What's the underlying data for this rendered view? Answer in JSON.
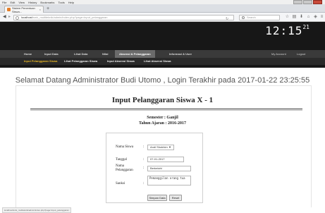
{
  "menubar": {
    "items": [
      "File",
      "Edit",
      "View",
      "History",
      "Bookmarks",
      "Tools",
      "Help"
    ]
  },
  "browser": {
    "tab_title": "Sistem Penentuan Siswa...",
    "new_tab": "+",
    "url_host": "localhost",
    "url_path": "/smk_multiteknik/admin/index.php?page=input_pelanggaran",
    "search_placeholder": "Search"
  },
  "clock": {
    "time": "12:15",
    "seconds": "21"
  },
  "mainnav": {
    "items": [
      "Home",
      "Input Data",
      "Lihat Data",
      "Nilai",
      "Absensi & Pelanggaran",
      "Informasi & User"
    ],
    "my_account": "My Account",
    "logout": "Logout"
  },
  "subnav": {
    "items": [
      "Input Pelanggaran Siswa",
      "Lihat Pelanggaran Siswa",
      "Input Absensi Siswa",
      "Lihat Absensi Siswa"
    ]
  },
  "welcome": "Selamat Datang Administrator Budi Utomo , Login Terakhir pada 2017-01-22 23:25:55",
  "form": {
    "title": "Input Pelanggaran Siswa X - 1",
    "semester": "Semester : Ganjil",
    "tahun_ajaran": "Tahun Ajaran : 2016-2017",
    "labels": {
      "nama_siswa": "Nama Siswa",
      "tanggal": "Tanggal",
      "nama_pelanggaran": "Nama Pelanggaran",
      "sanksi": "Sanksi"
    },
    "colon": ":",
    "values": {
      "nama_siswa": "Andi Shokhim",
      "tanggal": "07-01-2017",
      "nama_pelanggaran": "Berkelahi",
      "sanksi": "Pemanggilan orang tua"
    },
    "buttons": {
      "save": "Simpan Data",
      "reset": "Reset"
    }
  },
  "statusbar": {
    "text": "localhost/smk_multiteknik/admin/index.php?page=input_pelanggaran"
  }
}
